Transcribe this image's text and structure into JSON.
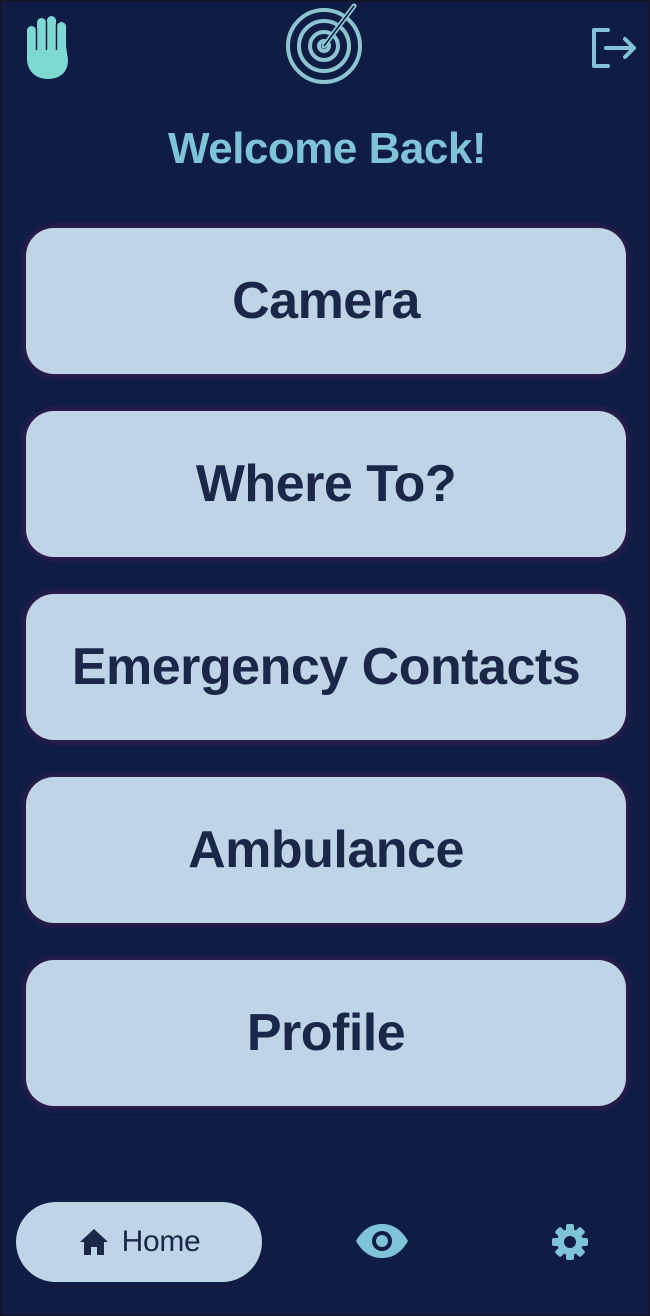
{
  "header": {
    "left_icon": "hand-icon",
    "center_icon": "radar-logo-icon",
    "right_icon": "logout-icon",
    "welcome_text": "Welcome Back!"
  },
  "menu": {
    "items": [
      {
        "label": "Camera"
      },
      {
        "label": "Where To?"
      },
      {
        "label": "Emergency Contacts"
      },
      {
        "label": "Ambulance"
      },
      {
        "label": "Profile"
      }
    ]
  },
  "bottom_nav": {
    "home_label": "Home",
    "home_icon": "home-icon",
    "eye_icon": "eye-icon",
    "settings_icon": "gear-icon"
  },
  "colors": {
    "background": "#0f1d45",
    "accent": "#7fc3d6",
    "button": "#bfd4e6",
    "button_text": "#1a2748"
  }
}
